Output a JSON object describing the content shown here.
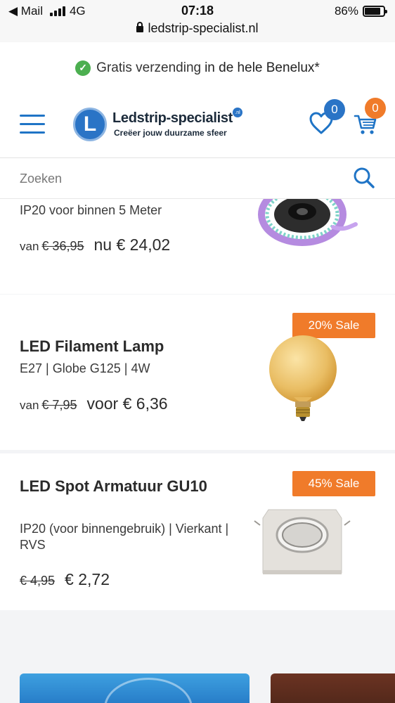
{
  "status_bar": {
    "back_app": "◀ Mail",
    "network": "4G",
    "time": "07:18",
    "battery": "86%",
    "battery_level": 0.86,
    "url": "ledstrip-specialist.nl"
  },
  "shipping_banner": {
    "text": "Gratis verzending",
    "highlight": "in de hele Benelux*"
  },
  "header": {
    "logo_letter": "L",
    "logo_name": "Ledstrip-specialist",
    "logo_tld": ".nl",
    "logo_tagline": "Creëer jouw duurzame sfeer",
    "wishlist_count": "0",
    "cart_count": "0"
  },
  "search": {
    "placeholder": "Zoeken"
  },
  "products": [
    {
      "subtitle": "IP20 voor binnen 5 Meter",
      "van_label": "van",
      "old_price": "€ 36,95",
      "new_price": "nu € 24,02"
    },
    {
      "sale": "20% Sale",
      "title": "LED Filament Lamp",
      "subtitle": "E27 | Globe G125 | 4W",
      "van_label": "van",
      "old_price": "€ 7,95",
      "new_price": "voor € 6,36"
    },
    {
      "sale": "45% Sale",
      "title": "LED Spot Armatuur GU10",
      "subtitle": "IP20 (voor binnengebruik) | Vierkant | RVS",
      "old_price": "€ 4,95",
      "new_price": "€ 2,72"
    }
  ],
  "colors": {
    "brand_blue": "#2a74c6",
    "sale_orange": "#f07b2a",
    "check_green": "#4caf50"
  },
  "icons": [
    "menu-icon",
    "heart-icon",
    "cart-icon",
    "search-icon",
    "check-icon",
    "lock-icon"
  ]
}
